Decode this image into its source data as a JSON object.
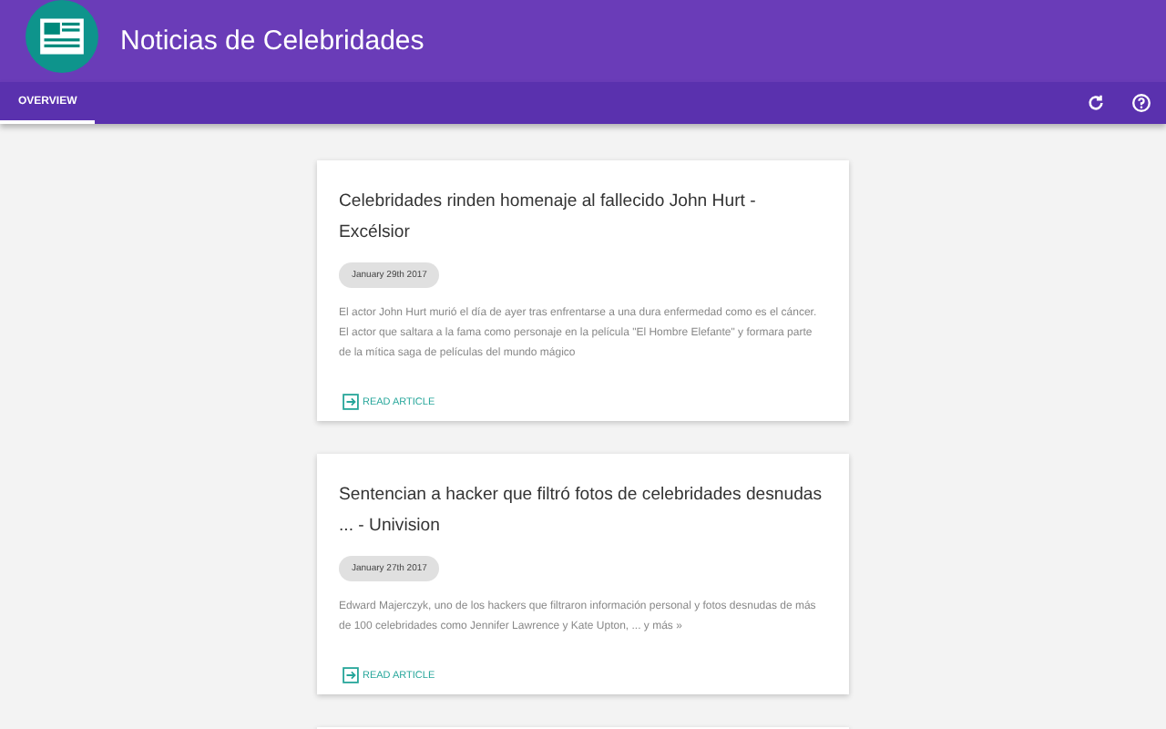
{
  "app": {
    "title": "Noticias de Celebridades"
  },
  "tabs": [
    {
      "label": "OVERVIEW",
      "selected": true
    }
  ],
  "articles": [
    {
      "title": "Celebridades rinden homenaje al fallecido John Hurt - Excélsior",
      "date": "January 29th 2017",
      "summary": "El actor John Hurt murió el día de ayer tras enfrentarse a una dura enfermedad como es el cáncer. El actor que saltara a la fama como personaje en la película \"El Hombre Elefante\" y formara parte de la mítica saga de películas del mundo mágico",
      "action": "READ ARTICLE"
    },
    {
      "title": "Sentencian a hacker que filtró fotos de celebridades desnudas ... - Univision",
      "date": "January 27th 2017",
      "summary": "Edward Majerczyk, uno de los hackers que filtraron información personal y fotos desnudas de más de 100 celebridades como Jennifer Lawrence y Kate Upton, ... y más »",
      "action": "READ ARTICLE"
    }
  ]
}
